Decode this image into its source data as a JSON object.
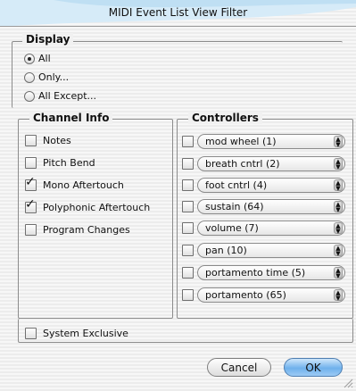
{
  "window": {
    "title": "MIDI Event List View Filter"
  },
  "display": {
    "legend": "Display",
    "options": [
      {
        "label": "All",
        "selected": true
      },
      {
        "label": "Only...",
        "selected": false
      },
      {
        "label": "All Except...",
        "selected": false
      }
    ]
  },
  "channel_info": {
    "legend": "Channel Info",
    "items": [
      {
        "label": "Notes",
        "checked": false
      },
      {
        "label": "Pitch Bend",
        "checked": false
      },
      {
        "label": "Mono Aftertouch",
        "checked": true
      },
      {
        "label": "Polyphonic Aftertouch",
        "checked": true
      },
      {
        "label": "Program Changes",
        "checked": false
      }
    ]
  },
  "controllers": {
    "legend": "Controllers",
    "items": [
      {
        "value": "mod wheel (1)",
        "checked": false
      },
      {
        "value": "breath cntrl (2)",
        "checked": false
      },
      {
        "value": "foot cntrl (4)",
        "checked": false
      },
      {
        "value": "sustain (64)",
        "checked": false
      },
      {
        "value": "volume (7)",
        "checked": false
      },
      {
        "value": "pan (10)",
        "checked": false
      },
      {
        "value": "portamento time (5)",
        "checked": false
      },
      {
        "value": "portamento (65)",
        "checked": false
      }
    ]
  },
  "system_exclusive": {
    "label": "System Exclusive",
    "checked": false
  },
  "buttons": {
    "cancel": "Cancel",
    "ok": "OK"
  },
  "colors": {
    "ok_button": "#6fb1ec",
    "title_wave": "#cfe6f5"
  }
}
